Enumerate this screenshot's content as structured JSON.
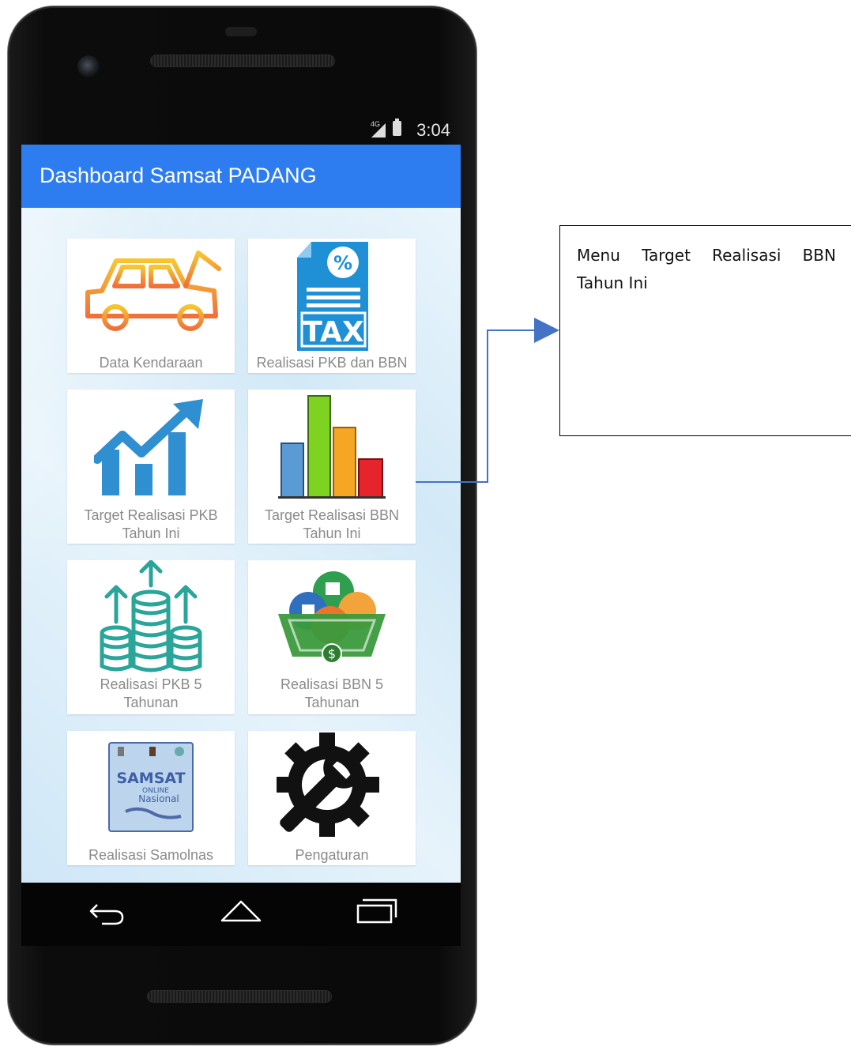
{
  "status_bar": {
    "time": "3:04",
    "network": "4G"
  },
  "app_bar": {
    "title": "Dashboard Samsat PADANG"
  },
  "menu": {
    "tiles": [
      {
        "label": "Data Kendaraan"
      },
      {
        "label": "Realisasi PKB dan BBN"
      },
      {
        "label": "Target Realisasi PKB\nTahun Ini"
      },
      {
        "label": "Target Realisasi BBN\nTahun Ini"
      },
      {
        "label": "Realisasi PKB 5\nTahunan"
      },
      {
        "label": "Realisasi BBN 5\nTahunan"
      },
      {
        "label": "Realisasi Samolnas"
      },
      {
        "label": "Pengaturan"
      }
    ],
    "tax_icon_text": "TAX",
    "samsat_logo_text": "SAMSAT",
    "samsat_logo_sub": "ONLINE",
    "samsat_logo_sub2": "Nasional"
  },
  "annotation": {
    "text": "Menu Target Realisasi BBN Tahun Ini"
  },
  "colors": {
    "app_bar": "#2e7df0",
    "connector": "#4472c4"
  }
}
